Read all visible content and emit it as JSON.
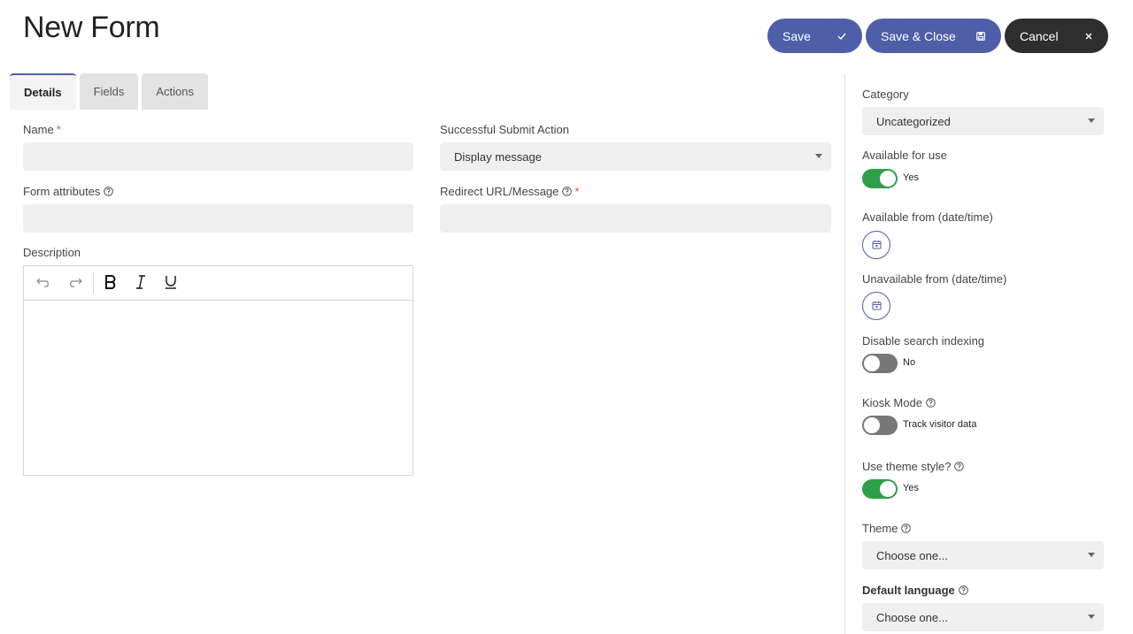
{
  "header": {
    "title": "New Form",
    "save_label": "Save",
    "save_close_label": "Save & Close",
    "cancel_label": "Cancel"
  },
  "tabs": [
    {
      "label": "Details",
      "active": true
    },
    {
      "label": "Fields",
      "active": false
    },
    {
      "label": "Actions",
      "active": false
    }
  ],
  "main": {
    "name_label": "Name",
    "name_value": "",
    "form_attributes_label": "Form attributes",
    "form_attributes_value": "",
    "description_label": "Description",
    "submit_action_label": "Successful Submit Action",
    "submit_action_value": "Display message",
    "redirect_label": "Redirect URL/Message",
    "redirect_value": "",
    "required_mark": "*"
  },
  "sidebar": {
    "category_label": "Category",
    "category_value": "Uncategorized",
    "available_label": "Available for use",
    "available_state": "Yes",
    "available_from_label": "Available from (date/time)",
    "unavailable_from_label": "Unavailable from (date/time)",
    "disable_search_label": "Disable search indexing",
    "disable_search_state": "No",
    "kiosk_label": "Kiosk Mode",
    "kiosk_state": "Track visitor data",
    "theme_style_label": "Use theme style?",
    "theme_style_state": "Yes",
    "theme_label": "Theme",
    "theme_value": "Choose one...",
    "default_language_label": "Default language",
    "default_language_value": "Choose one..."
  },
  "colors": {
    "primary": "#4e5ea8",
    "dark": "#2e2e2e",
    "toggle_on": "#2e9e4a",
    "toggle_off": "#777777",
    "required": "#d9534f"
  },
  "icons": {
    "save": "check-icon",
    "save_close": "floppy-disk-icon",
    "cancel": "close-icon",
    "help": "question-circle-icon",
    "calendar": "calendar-icon"
  }
}
